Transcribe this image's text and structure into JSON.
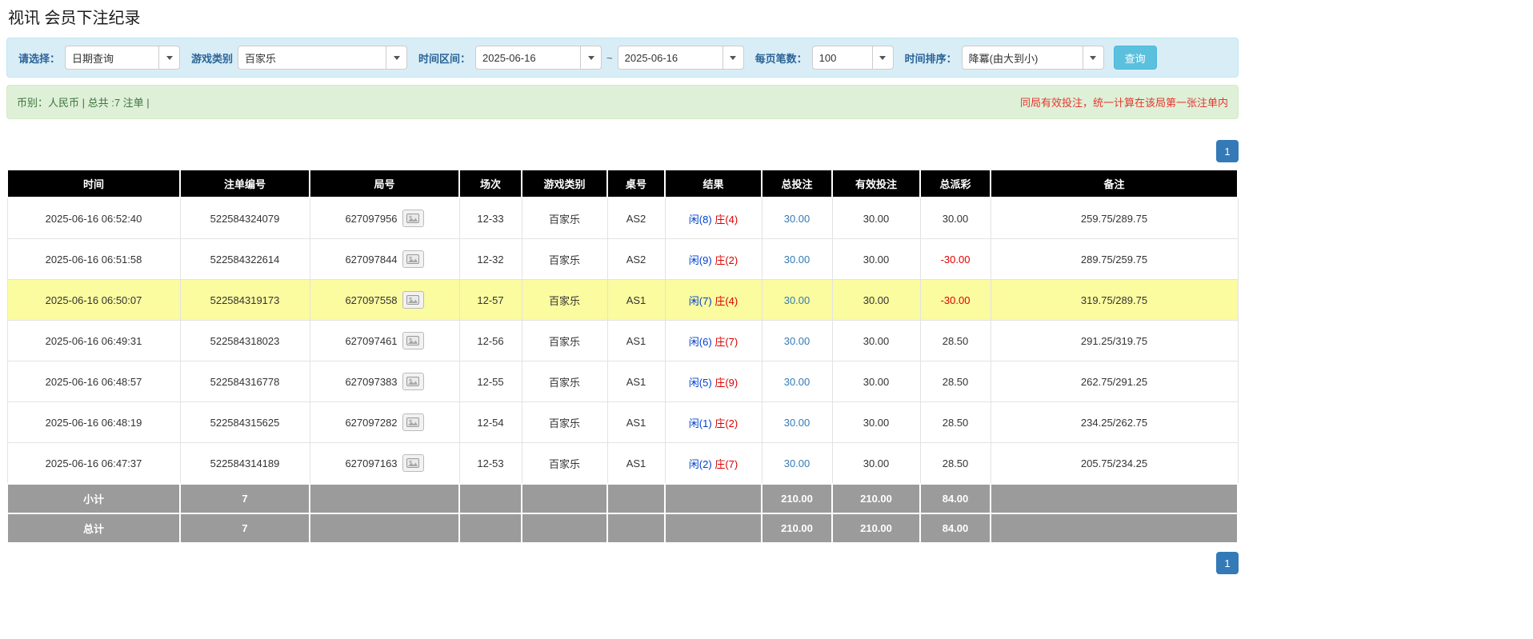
{
  "page": {
    "title": "视讯 会员下注纪录"
  },
  "filters": {
    "select_label": "请选择：",
    "select_value": "日期查询",
    "game_label": "游戏类别",
    "game_value": "百家乐",
    "range_label": "时间区间：",
    "date_from": "2025-06-16",
    "tilde": "~",
    "date_to": "2025-06-16",
    "page_size_label": "每页笔数：",
    "page_size_value": "100",
    "sort_label": "时间排序：",
    "sort_value": "降冪(由大到小)",
    "search_button": "查询"
  },
  "summary": {
    "left": "币别：人民币 | 总共 :7 注单 |",
    "right": "同局有效投注，统一计算在该局第一张注单内"
  },
  "pagination": {
    "page": "1"
  },
  "table": {
    "headers": [
      "时间",
      "注单编号",
      "局号",
      "场次",
      "游戏类别",
      "桌号",
      "结果",
      "总投注",
      "有效投注",
      "总派彩",
      "备注"
    ],
    "rows": [
      {
        "time": "2025-06-16 06:52:40",
        "bet_id": "522584324079",
        "round_id": "627097956",
        "session": "12-33",
        "game": "百家乐",
        "table_no": "AS2",
        "result_player": "闲(8)",
        "result_banker": "庄(4)",
        "total_bet": "30.00",
        "valid_bet": "30.00",
        "payout": "30.00",
        "payout_negative": false,
        "note": "259.75/289.75",
        "highlight": false
      },
      {
        "time": "2025-06-16 06:51:58",
        "bet_id": "522584322614",
        "round_id": "627097844",
        "session": "12-32",
        "game": "百家乐",
        "table_no": "AS2",
        "result_player": "闲(9)",
        "result_banker": "庄(2)",
        "total_bet": "30.00",
        "valid_bet": "30.00",
        "payout": "-30.00",
        "payout_negative": true,
        "note": "289.75/259.75",
        "highlight": false
      },
      {
        "time": "2025-06-16 06:50:07",
        "bet_id": "522584319173",
        "round_id": "627097558",
        "session": "12-57",
        "game": "百家乐",
        "table_no": "AS1",
        "result_player": "闲(7)",
        "result_banker": "庄(4)",
        "total_bet": "30.00",
        "valid_bet": "30.00",
        "payout": "-30.00",
        "payout_negative": true,
        "note": "319.75/289.75",
        "highlight": true
      },
      {
        "time": "2025-06-16 06:49:31",
        "bet_id": "522584318023",
        "round_id": "627097461",
        "session": "12-56",
        "game": "百家乐",
        "table_no": "AS1",
        "result_player": "闲(6)",
        "result_banker": "庄(7)",
        "total_bet": "30.00",
        "valid_bet": "30.00",
        "payout": "28.50",
        "payout_negative": false,
        "note": "291.25/319.75",
        "highlight": false
      },
      {
        "time": "2025-06-16 06:48:57",
        "bet_id": "522584316778",
        "round_id": "627097383",
        "session": "12-55",
        "game": "百家乐",
        "table_no": "AS1",
        "result_player": "闲(5)",
        "result_banker": "庄(9)",
        "total_bet": "30.00",
        "valid_bet": "30.00",
        "payout": "28.50",
        "payout_negative": false,
        "note": "262.75/291.25",
        "highlight": false
      },
      {
        "time": "2025-06-16 06:48:19",
        "bet_id": "522584315625",
        "round_id": "627097282",
        "session": "12-54",
        "game": "百家乐",
        "table_no": "AS1",
        "result_player": "闲(1)",
        "result_banker": "庄(2)",
        "total_bet": "30.00",
        "valid_bet": "30.00",
        "payout": "28.50",
        "payout_negative": false,
        "note": "234.25/262.75",
        "highlight": false
      },
      {
        "time": "2025-06-16 06:47:37",
        "bet_id": "522584314189",
        "round_id": "627097163",
        "session": "12-53",
        "game": "百家乐",
        "table_no": "AS1",
        "result_player": "闲(2)",
        "result_banker": "庄(7)",
        "total_bet": "30.00",
        "valid_bet": "30.00",
        "payout": "28.50",
        "payout_negative": false,
        "note": "205.75/234.25",
        "highlight": false
      }
    ],
    "footer_rows": [
      {
        "label": "小计",
        "count": "7",
        "total_bet": "210.00",
        "valid_bet": "210.00",
        "payout": "84.00"
      },
      {
        "label": "总计",
        "count": "7",
        "total_bet": "210.00",
        "valid_bet": "210.00",
        "payout": "84.00"
      }
    ]
  },
  "colors": {
    "filter_bar_bg": "#d9edf7",
    "summary_bar_bg": "#dff0d8",
    "table_header_bg": "#000000",
    "highlight_row_bg": "#fbfb9f",
    "footer_row_bg": "#9b9b9b",
    "accent_blue": "#337ab7",
    "search_button_bg": "#5bc0de",
    "player_color": "#0040cc",
    "banker_color": "#d80000",
    "negative_color": "#e20000",
    "notice_color": "#e5382f"
  }
}
